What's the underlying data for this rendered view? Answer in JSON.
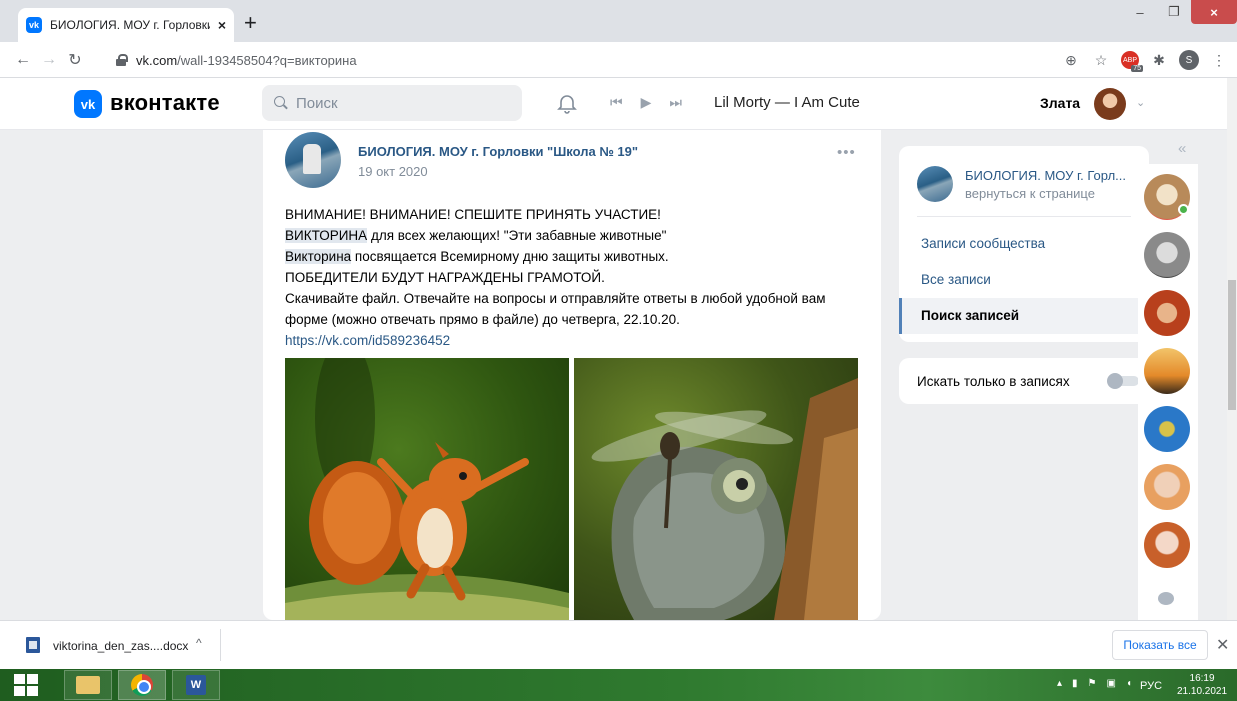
{
  "browser": {
    "tab_title": "БИОЛОГИЯ. МОУ г. Горловки \"Ш",
    "tab_close": "×",
    "new_tab": "+",
    "url_host": "vk.com",
    "url_path": "/wall-193458504?q=викторина",
    "ext_badge": "75",
    "profile_letter": "S"
  },
  "vk_header": {
    "logo_text": "вконтакте",
    "search_placeholder": "Поиск",
    "track": "Lil Morty — I Am Cute",
    "user_name": "Злата"
  },
  "post": {
    "author": "БИОЛОГИЯ. МОУ г. Горловки \"Школа № 19\"",
    "date": "19 окт 2020",
    "more": "•••",
    "line1": "ВНИМАНИЕ! ВНИМАНИЕ! СПЕШИТЕ ПРИНЯТЬ УЧАСТИЕ!",
    "line2_highlight": "ВИКТОРИНА",
    "line2_rest": " для всех желающих! \"Эти забавные животные\"",
    "line3_highlight": "Викторина",
    "line3_rest": " посвящается Всемирному дню защиты животных.",
    "line4": "ПОБЕДИТЕЛИ БУДУТ НАГРАЖДЕНЫ ГРАМОТОЙ.",
    "line5": "Скачивайте файл. Отвечайте на вопросы и отправляйте ответы в любой удобной вам форме (можно отвечать прямо в файле) до четверга, 22.10.20.",
    "link": "https://vk.com/id589236452"
  },
  "sidebar": {
    "group_title": "БИОЛОГИЯ. МОУ г. Горл...",
    "back_link": "вернуться к странице",
    "items": [
      {
        "label": "Записи сообщества"
      },
      {
        "label": "Все записи"
      },
      {
        "label": "Поиск записей"
      }
    ],
    "filter_label": "Искать только в записях",
    "filter_enabled": false
  },
  "download_bar": {
    "file_name": "viktorina_den_zas....docx",
    "show_all": "Показать все"
  },
  "taskbar": {
    "language": "РУС",
    "time": "16:19",
    "date": "21.10.2021"
  }
}
